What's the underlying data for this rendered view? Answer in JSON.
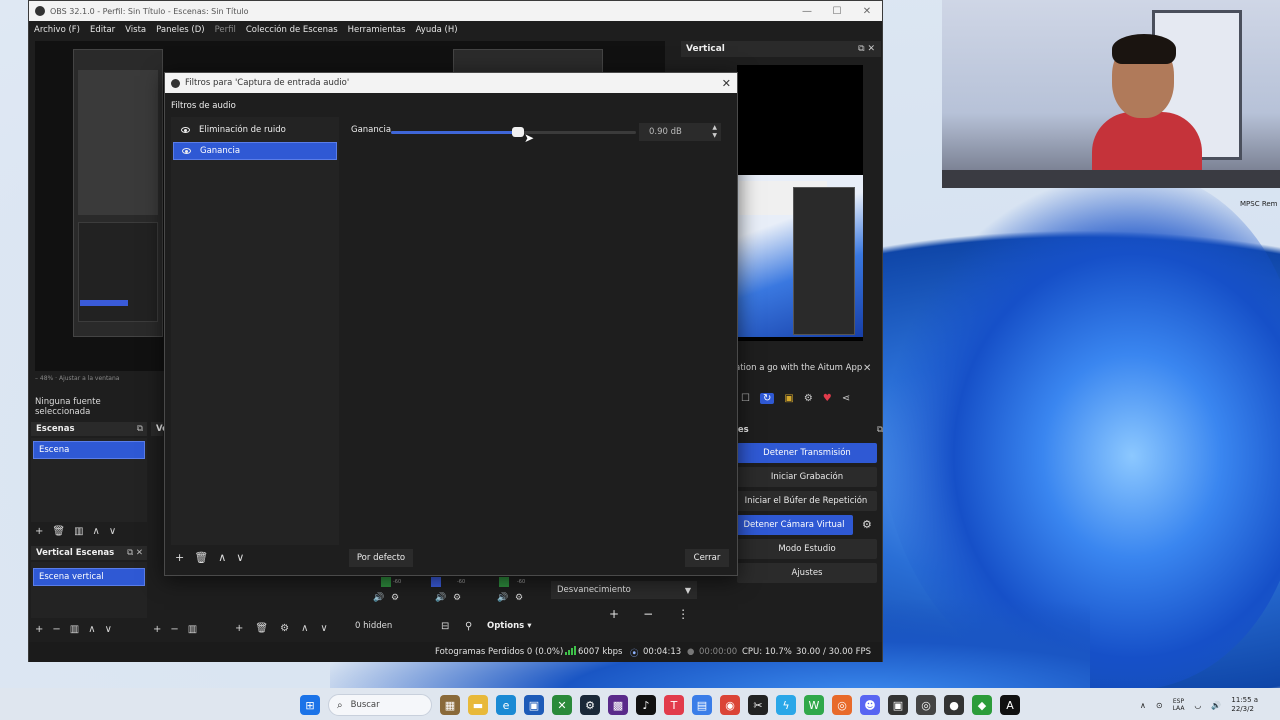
{
  "window": {
    "title": "OBS 32.1.0 - Perfil: Sin Título - Escenas: Sin Título",
    "menu": [
      "Archivo (F)",
      "Editar",
      "Vista",
      "Paneles (D)",
      "Perfil",
      "Colección de Escenas",
      "Herramientas",
      "Ayuda (H)"
    ]
  },
  "preview": {
    "status_strip": "–  48%   ·   Ajustar a la ventana",
    "no_source": "Ninguna fuente seleccionada"
  },
  "scenes": {
    "title": "Escenas",
    "items": [
      "Escena"
    ]
  },
  "vertical_scenes": {
    "title": "Vertical Escenas",
    "items": [
      "Escena vertical"
    ]
  },
  "sources_title_partial": "Ve",
  "vertical_dock": {
    "title": "Vertical"
  },
  "altum": {
    "banner": "ation a go with the Aitum App"
  },
  "controls": {
    "title_partial": "les",
    "buttons": [
      "Detener Transmisión",
      "Iniciar Grabación",
      "Iniciar el Búfer de Repetición",
      "Detener Cámara Virtual",
      "Modo Estudio",
      "Ajustes"
    ]
  },
  "mixer": {
    "db_labels": [
      "-60",
      "-60",
      "-60"
    ]
  },
  "transition": {
    "selected": "Desvanecimiento"
  },
  "sources": {
    "hidden_count": "0 hidden",
    "options": "Options"
  },
  "statusbar": {
    "dropped": "Fotogramas Perdidos 0 (0.0%)",
    "bitrate": "6007 kbps",
    "stream_time": "00:04:13",
    "rec_time": "00:00:00",
    "cpu": "CPU: 10.7%",
    "fps": "30.00 / 30.00 FPS"
  },
  "dialog": {
    "title": "Filtros para 'Captura de entrada audio'",
    "section": "Filtros de audio",
    "filters": [
      {
        "name": "Eliminación de ruido",
        "selected": false
      },
      {
        "name": "Ganancia",
        "selected": true
      }
    ],
    "gain_label": "Ganancia",
    "gain_value": "0.90 dB",
    "gain_level": 0.52,
    "default_button": "Por defecto",
    "close_button": "Cerrar"
  },
  "webcam": {
    "label": "MPSC Rem"
  },
  "taskbar": {
    "search_placeholder": "Buscar",
    "lang_top": "ESP",
    "lang_bottom": "LAA",
    "time": "11:55 a",
    "date": "22/3/2"
  },
  "colors": {
    "accent": "#2f59d4",
    "panel": "#1e1e1e"
  }
}
